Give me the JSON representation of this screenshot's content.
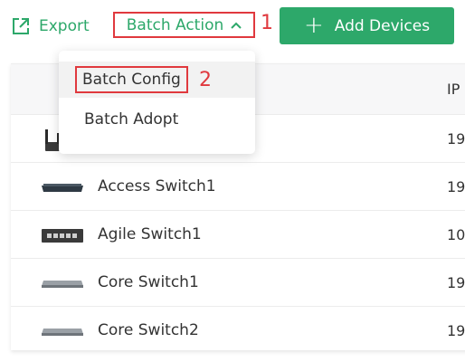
{
  "toolbar": {
    "export_label": "Export",
    "batch_action_label": "Batch Action",
    "add_devices_label": "Add Devices",
    "plus_symbol": "+"
  },
  "annotations": {
    "step1": "1",
    "step2": "2"
  },
  "menu": {
    "items": [
      {
        "label": "Batch Config"
      },
      {
        "label": "Batch Adopt"
      }
    ]
  },
  "table": {
    "columns": {
      "ip": "IP"
    },
    "rows": [
      {
        "name": "",
        "ip": "19.",
        "icon": "router-icon"
      },
      {
        "name": "Access Switch1",
        "ip": "19.",
        "icon": "switch-icon"
      },
      {
        "name": "Agile Switch1",
        "ip": "10.",
        "icon": "switch-icon"
      },
      {
        "name": "Core Switch1",
        "ip": "19.",
        "icon": "switch-icon"
      },
      {
        "name": "Core Switch2",
        "ip": "19.",
        "icon": "switch-icon"
      }
    ]
  },
  "colors": {
    "accent": "#2da86a",
    "highlight": "#e0393e"
  }
}
